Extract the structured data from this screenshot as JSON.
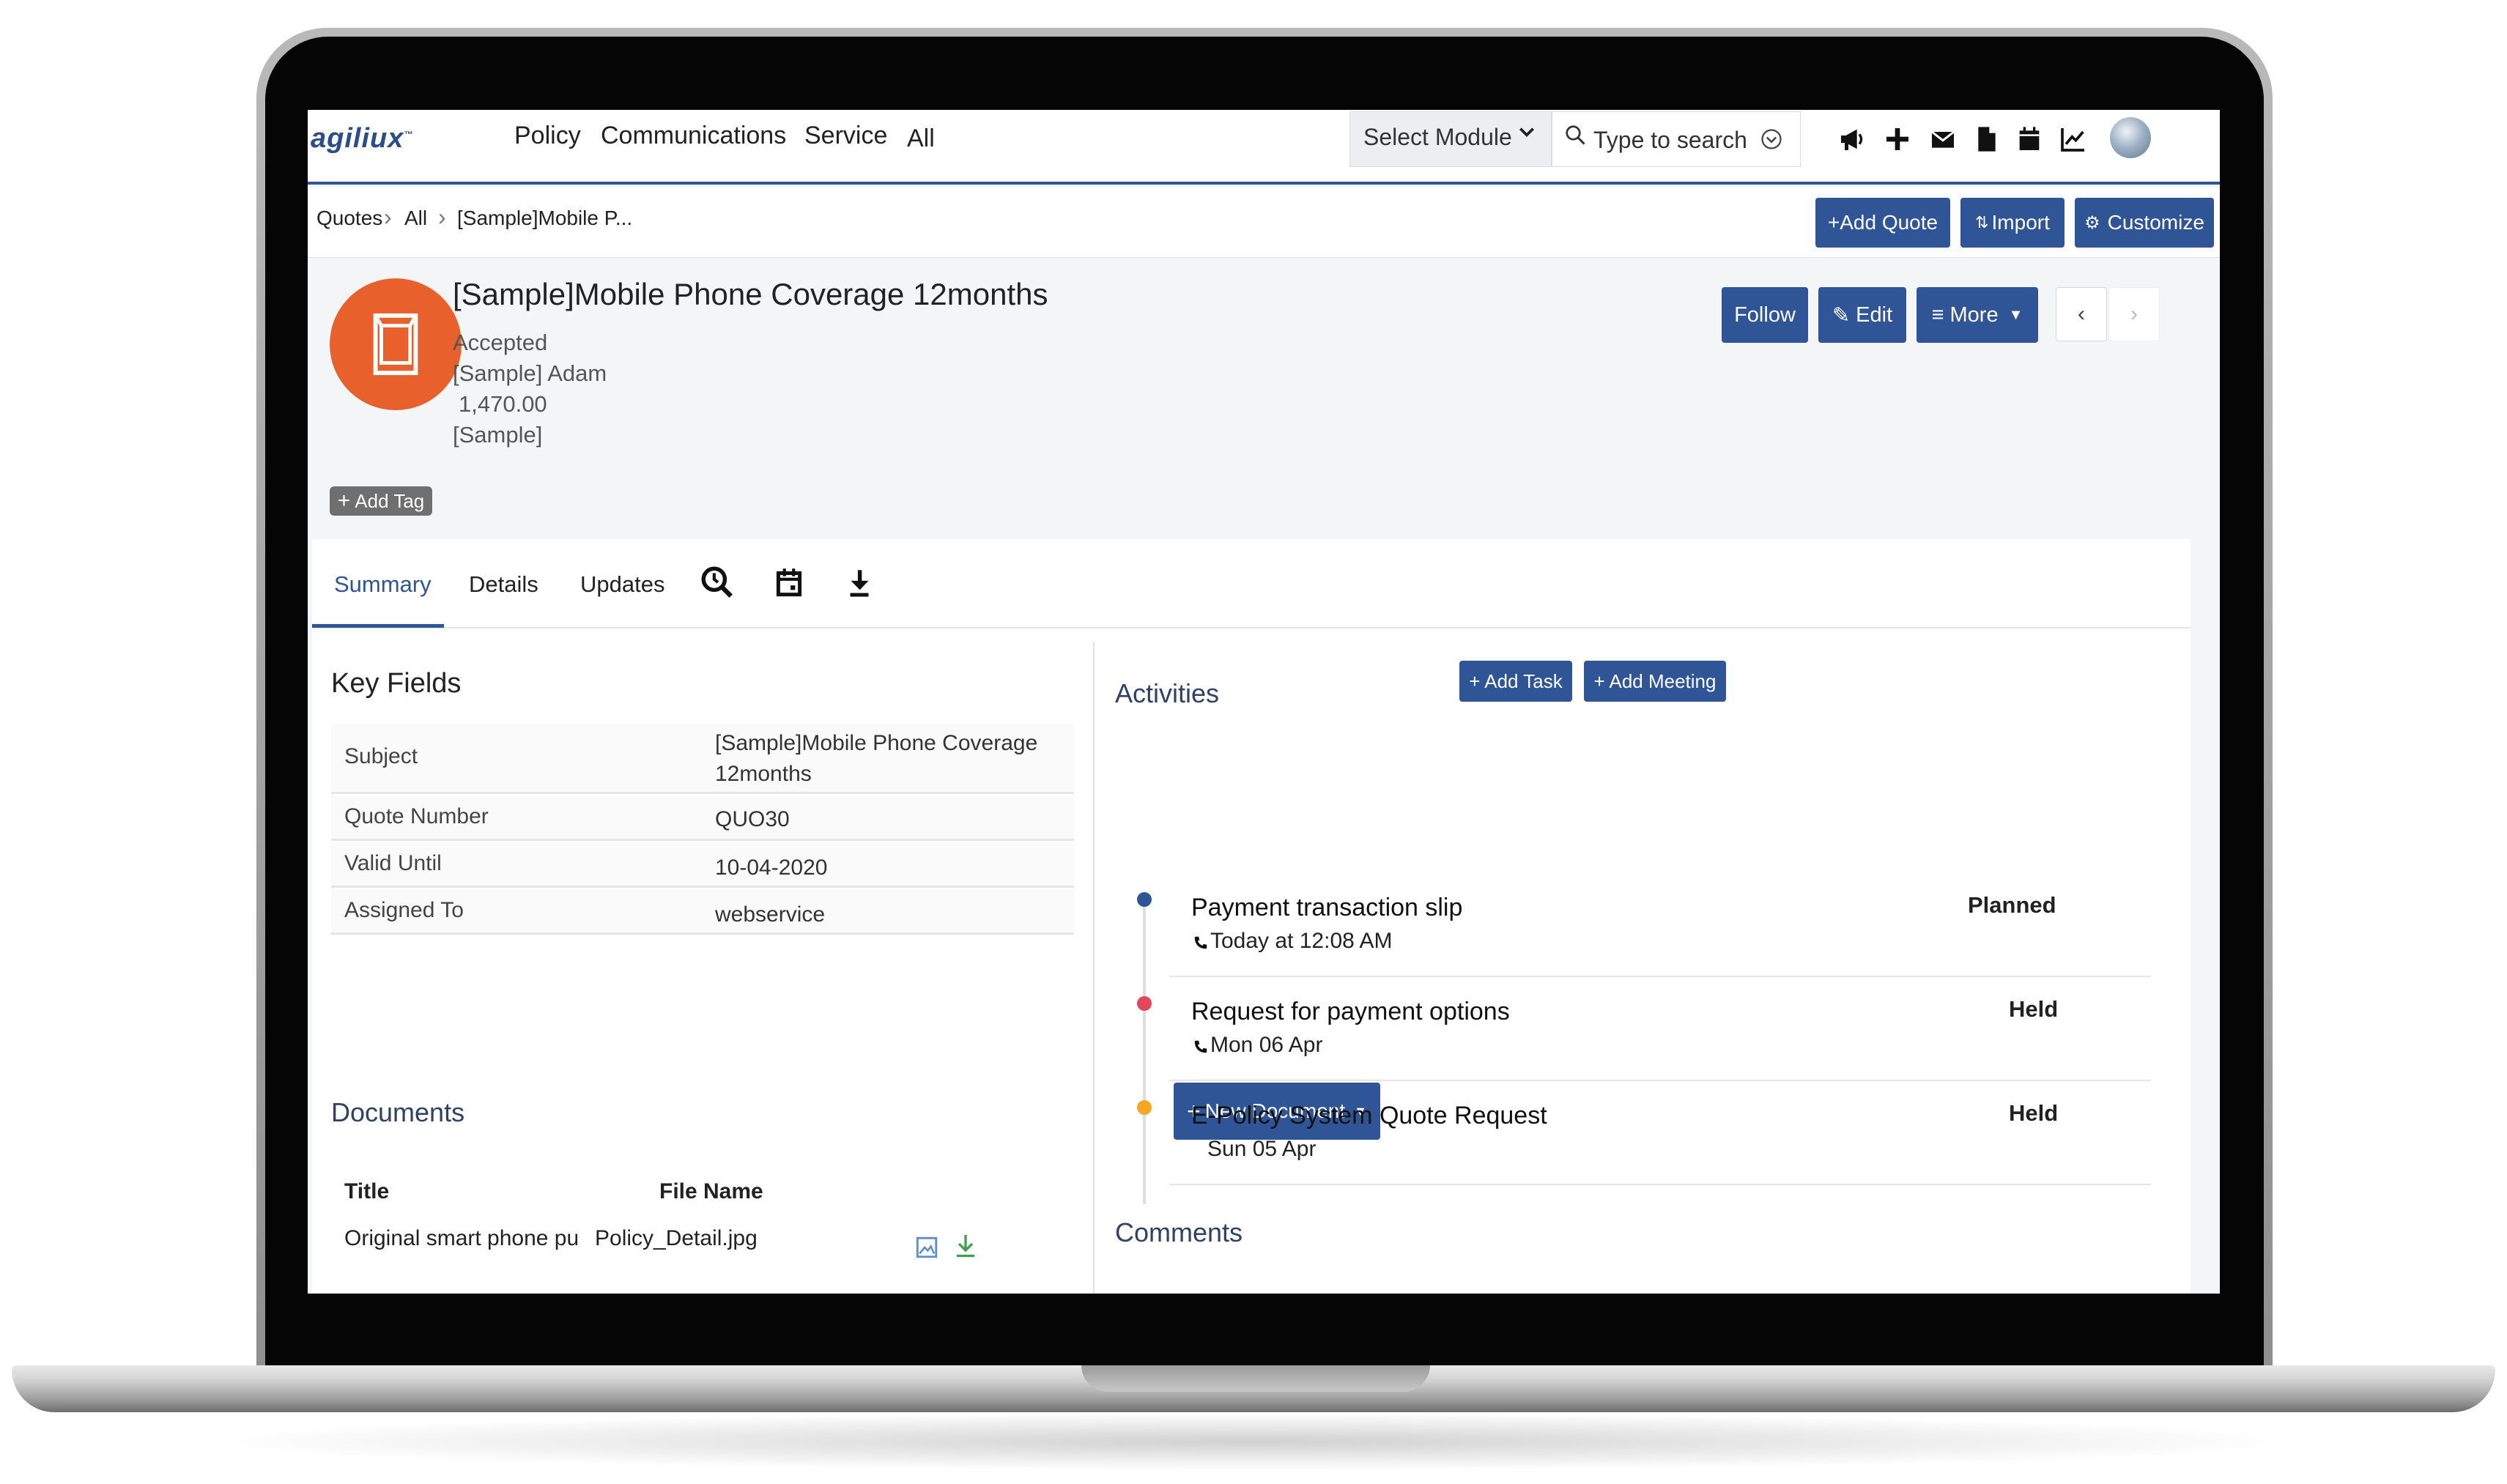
{
  "app": {
    "logo": "agiliux",
    "logo_mark": "™",
    "nav": [
      "Policy",
      "Communications",
      "Service",
      "All"
    ],
    "module_select": "Select Module",
    "search_placeholder": "Type to search"
  },
  "breadcrumb": [
    "Quotes",
    "All",
    "[Sample]Mobile P..."
  ],
  "actions": {
    "add_quote": "+Add Quote",
    "import": "Import",
    "customize": "Customize"
  },
  "record": {
    "title": "[Sample]Mobile Phone Coverage 12months",
    "status": "Accepted",
    "contact": "[Sample] Adam",
    "amount": "1,470.00",
    "org": "[Sample]",
    "add_tag": "Add Tag",
    "buttons": {
      "follow": "Follow",
      "edit": "Edit",
      "more": "More"
    },
    "prev": "‹",
    "next": "›"
  },
  "tabs": [
    "Summary",
    "Details",
    "Updates"
  ],
  "key_fields": {
    "title": "Key Fields",
    "rows": [
      {
        "label": "Subject",
        "value": "[Sample]Mobile Phone Coverage 12months"
      },
      {
        "label": "Quote Number",
        "value": "QUO30"
      },
      {
        "label": "Valid Until",
        "value": "10-04-2020"
      },
      {
        "label": "Assigned To",
        "value": "webservice"
      }
    ]
  },
  "documents": {
    "title": "Documents",
    "new_button": "New Document",
    "headers": [
      "Title",
      "File Name"
    ],
    "rows": [
      {
        "title": "Original smart phone purchase",
        "file": "Policy_Detail.jpg"
      }
    ]
  },
  "activities": {
    "title": "Activities",
    "add_task": "+ Add Task",
    "add_meeting": "+ Add Meeting",
    "items": [
      {
        "title": "Payment transaction slip",
        "when": "Today at 12:08 AM",
        "status": "Planned",
        "color": "#2f5596"
      },
      {
        "title": "Request for payment options",
        "when": "Mon 06 Apr",
        "status": "Held",
        "color": "#e2475b"
      },
      {
        "title": "E-Policy System Quote Request",
        "when": "Sun 05 Apr",
        "status": "Held",
        "color": "#f5a623"
      }
    ]
  },
  "comments": {
    "title": "Comments"
  },
  "colors": {
    "primary": "#2f5596",
    "record_icon": "#e8612c"
  }
}
